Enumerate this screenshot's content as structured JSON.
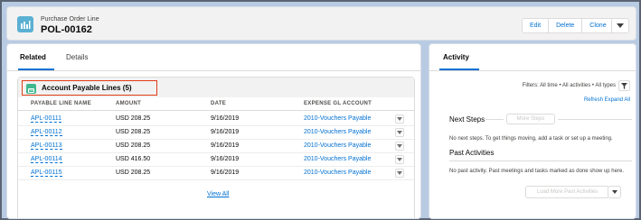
{
  "header": {
    "object_type": "Purchase Order Line",
    "record_name": "POL-00162",
    "buttons": {
      "edit": "Edit",
      "delete": "Delete",
      "clone": "Clone"
    }
  },
  "left_tabs": {
    "related": "Related",
    "details": "Details"
  },
  "related_list": {
    "title": "Account Payable Lines (5)",
    "columns": [
      "PAYABLE LINE NAME",
      "AMOUNT",
      "DATE",
      "EXPENSE GL ACCOUNT"
    ],
    "rows": [
      {
        "name": "APL-00111",
        "amount": "USD 208.25",
        "date": "9/16/2019",
        "account": "2010-Vouchers Payable"
      },
      {
        "name": "APL-00112",
        "amount": "USD 208.25",
        "date": "9/16/2019",
        "account": "2010-Vouchers Payable"
      },
      {
        "name": "APL-00113",
        "amount": "USD 208.25",
        "date": "9/16/2019",
        "account": "2010-Vouchers Payable"
      },
      {
        "name": "APL-00114",
        "amount": "USD 416.50",
        "date": "9/16/2019",
        "account": "2010-Vouchers Payable"
      },
      {
        "name": "APL-00115",
        "amount": "USD 208.25",
        "date": "9/16/2019",
        "account": "2010-Vouchers Payable"
      }
    ],
    "view_all": "View All"
  },
  "activity": {
    "tab": "Activity",
    "filters": "Filters: All time • All activities • All types",
    "refresh": "Refresh",
    "expand_all": "Expand All",
    "next_steps_title": "Next Steps",
    "more_steps": "More Steps",
    "next_steps_note": "No next steps. To get things moving, add a task or set up a meeting.",
    "past_title": "Past Activities",
    "past_note": "No past activity. Past meetings and tasks marked as done show up here.",
    "load_more": "Load More Past Activities"
  },
  "icons": {
    "object": "purchase-order-line-icon",
    "related_list": "account-payable-icon",
    "filter": "filter-icon",
    "dropdown": "chevron-down-icon"
  },
  "colors": {
    "link": "#0070d2",
    "highlight_border": "#e03c16",
    "object_icon": "#5ab0d2",
    "list_icon": "#3fb78f"
  }
}
